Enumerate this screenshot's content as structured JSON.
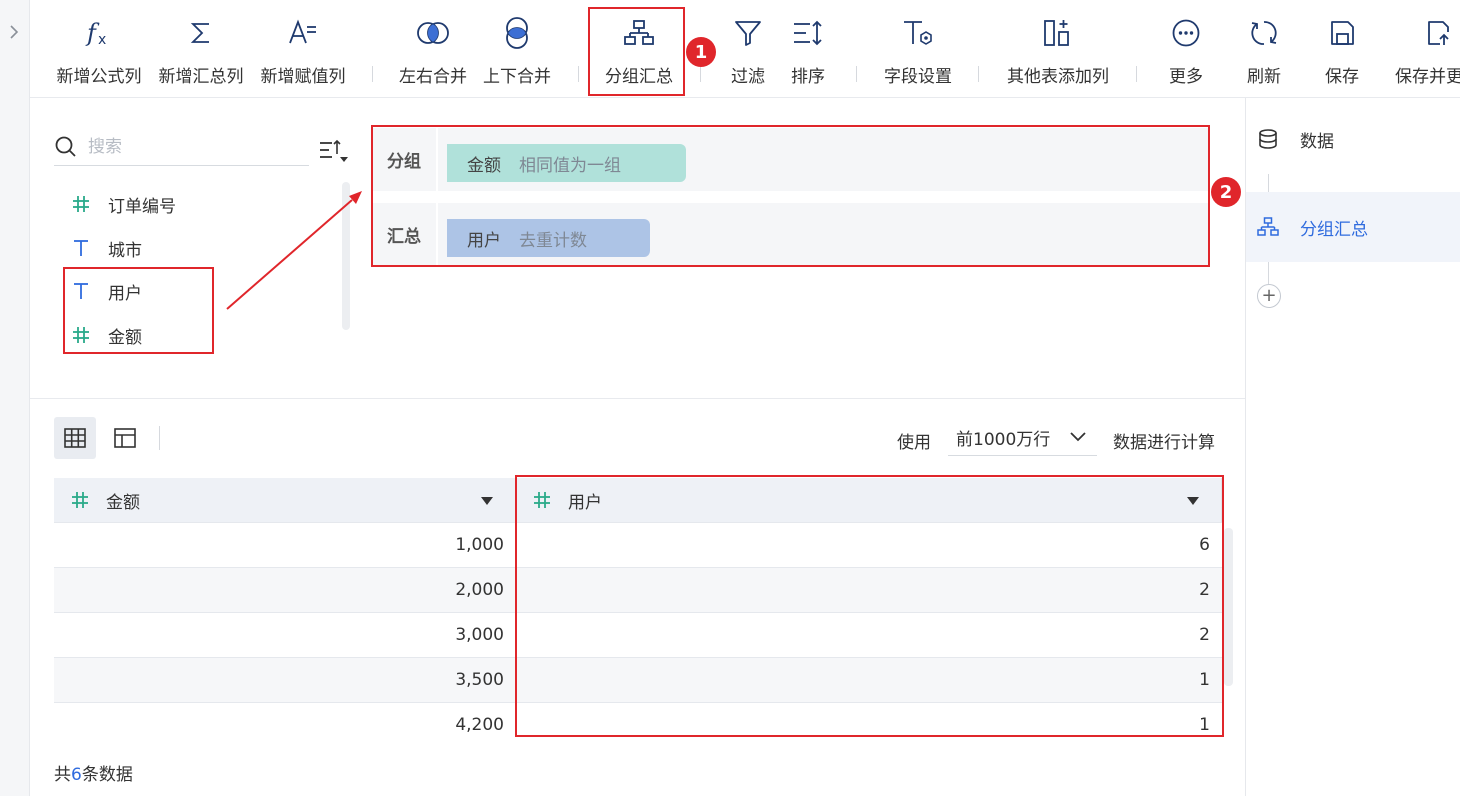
{
  "toolbar": {
    "add_formula": "新增公式列",
    "add_summary": "新增汇总列",
    "add_assign": "新增赋值列",
    "merge_lr": "左右合并",
    "merge_ud": "上下合并",
    "group_summary": "分组汇总",
    "filter": "过滤",
    "sort": "排序",
    "field_settings": "字段设置",
    "add_from_other": "其他表添加列",
    "more": "更多",
    "refresh": "刷新",
    "save": "保存",
    "save_update": "保存并更"
  },
  "badges": {
    "one": "1",
    "two": "2"
  },
  "field_panel": {
    "search_placeholder": "搜索",
    "fields": [
      {
        "name": "订单编号",
        "type": "number"
      },
      {
        "name": "城市",
        "type": "text"
      },
      {
        "name": "用户",
        "type": "text"
      },
      {
        "name": "金额",
        "type": "number"
      }
    ]
  },
  "config": {
    "group_label": "分组",
    "group_field": "金额",
    "group_mode": "相同值为一组",
    "summary_label": "汇总",
    "summary_field": "用户",
    "summary_mode": "去重计数"
  },
  "preview": {
    "use_label": "使用",
    "row_limit": "前1000万行",
    "calc_label": "数据进行计算",
    "columns": [
      "金额",
      "用户"
    ],
    "rows": [
      [
        "1,000",
        "6"
      ],
      [
        "2,000",
        "2"
      ],
      [
        "3,000",
        "2"
      ],
      [
        "3,500",
        "1"
      ],
      [
        "4,200",
        "1"
      ]
    ],
    "footer_prefix": "共",
    "footer_count": "6",
    "footer_suffix": "条数据"
  },
  "steps": {
    "data": "数据",
    "group_summary": "分组汇总"
  },
  "colors": {
    "accent": "#2f6bde",
    "highlight": "#e0262b",
    "group_pill": "#b0e1da",
    "summary_pill": "#adc4e6",
    "number_icon": "#2aaa8a",
    "text_icon": "#2f6bde",
    "icon_dark": "#1f3a6e"
  }
}
